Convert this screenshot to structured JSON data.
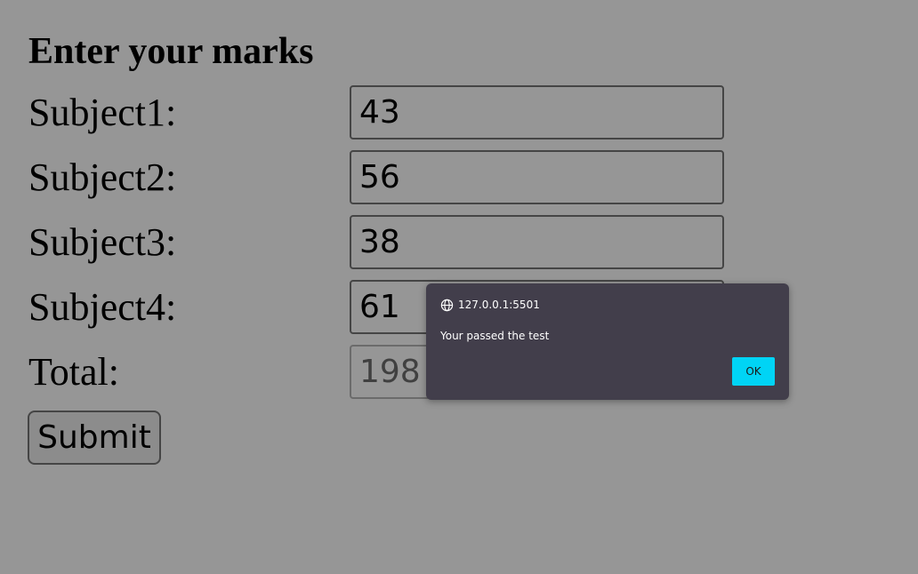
{
  "form": {
    "title": "Enter your marks",
    "rows": [
      {
        "label": "Subject1:",
        "value": "43"
      },
      {
        "label": "Subject2:",
        "value": "56"
      },
      {
        "label": "Subject3:",
        "value": "38"
      },
      {
        "label": "Subject4:",
        "value": "61"
      }
    ],
    "total": {
      "label": "Total:",
      "value": "198"
    },
    "submit_label": "Submit"
  },
  "alert": {
    "origin": "127.0.0.1:5501",
    "origin_icon": "globe-icon",
    "message": "Your passed the test",
    "ok_label": "OK",
    "ok_color": "#00d4f5",
    "background": "#423e4b"
  }
}
